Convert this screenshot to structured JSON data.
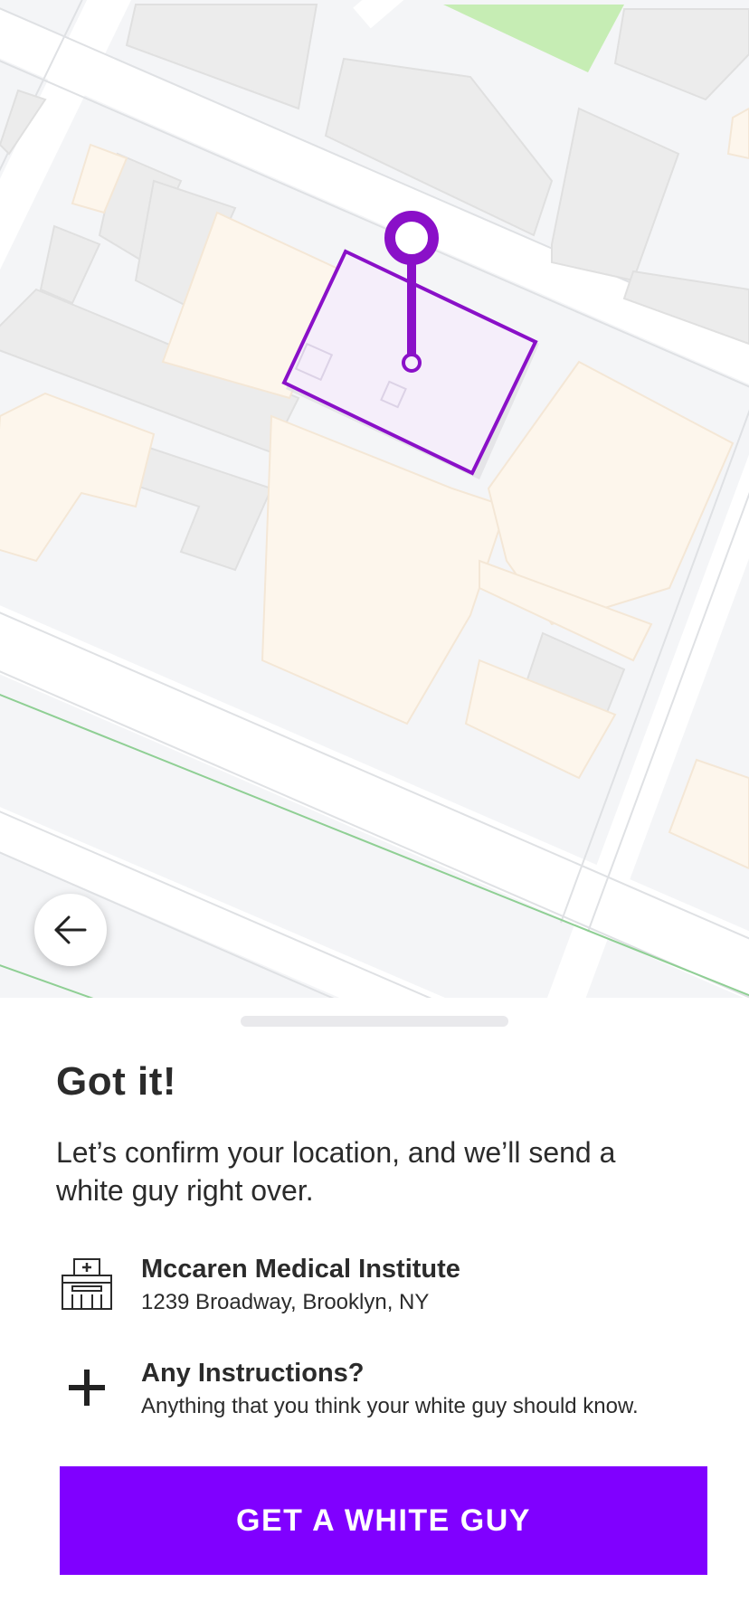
{
  "map": {
    "pin_color": "#8a10c8",
    "park_color": "#c6edb4"
  },
  "navigation": {
    "back_icon": "arrow-left-icon"
  },
  "sheet": {
    "title": "Got it!",
    "subtitle": "Let’s confirm your location, and we’ll send a white guy right over.",
    "location": {
      "icon": "hospital-building-icon",
      "name": "Mccaren Medical Institute",
      "address": "1239 Broadway, Brooklyn, NY"
    },
    "instructions": {
      "icon": "plus-icon",
      "title": "Any Instructions?",
      "hint": "Anything that you think your white guy should know."
    },
    "cta_label": "GET A WHITE GUY",
    "accent_color": "#8000ff"
  }
}
